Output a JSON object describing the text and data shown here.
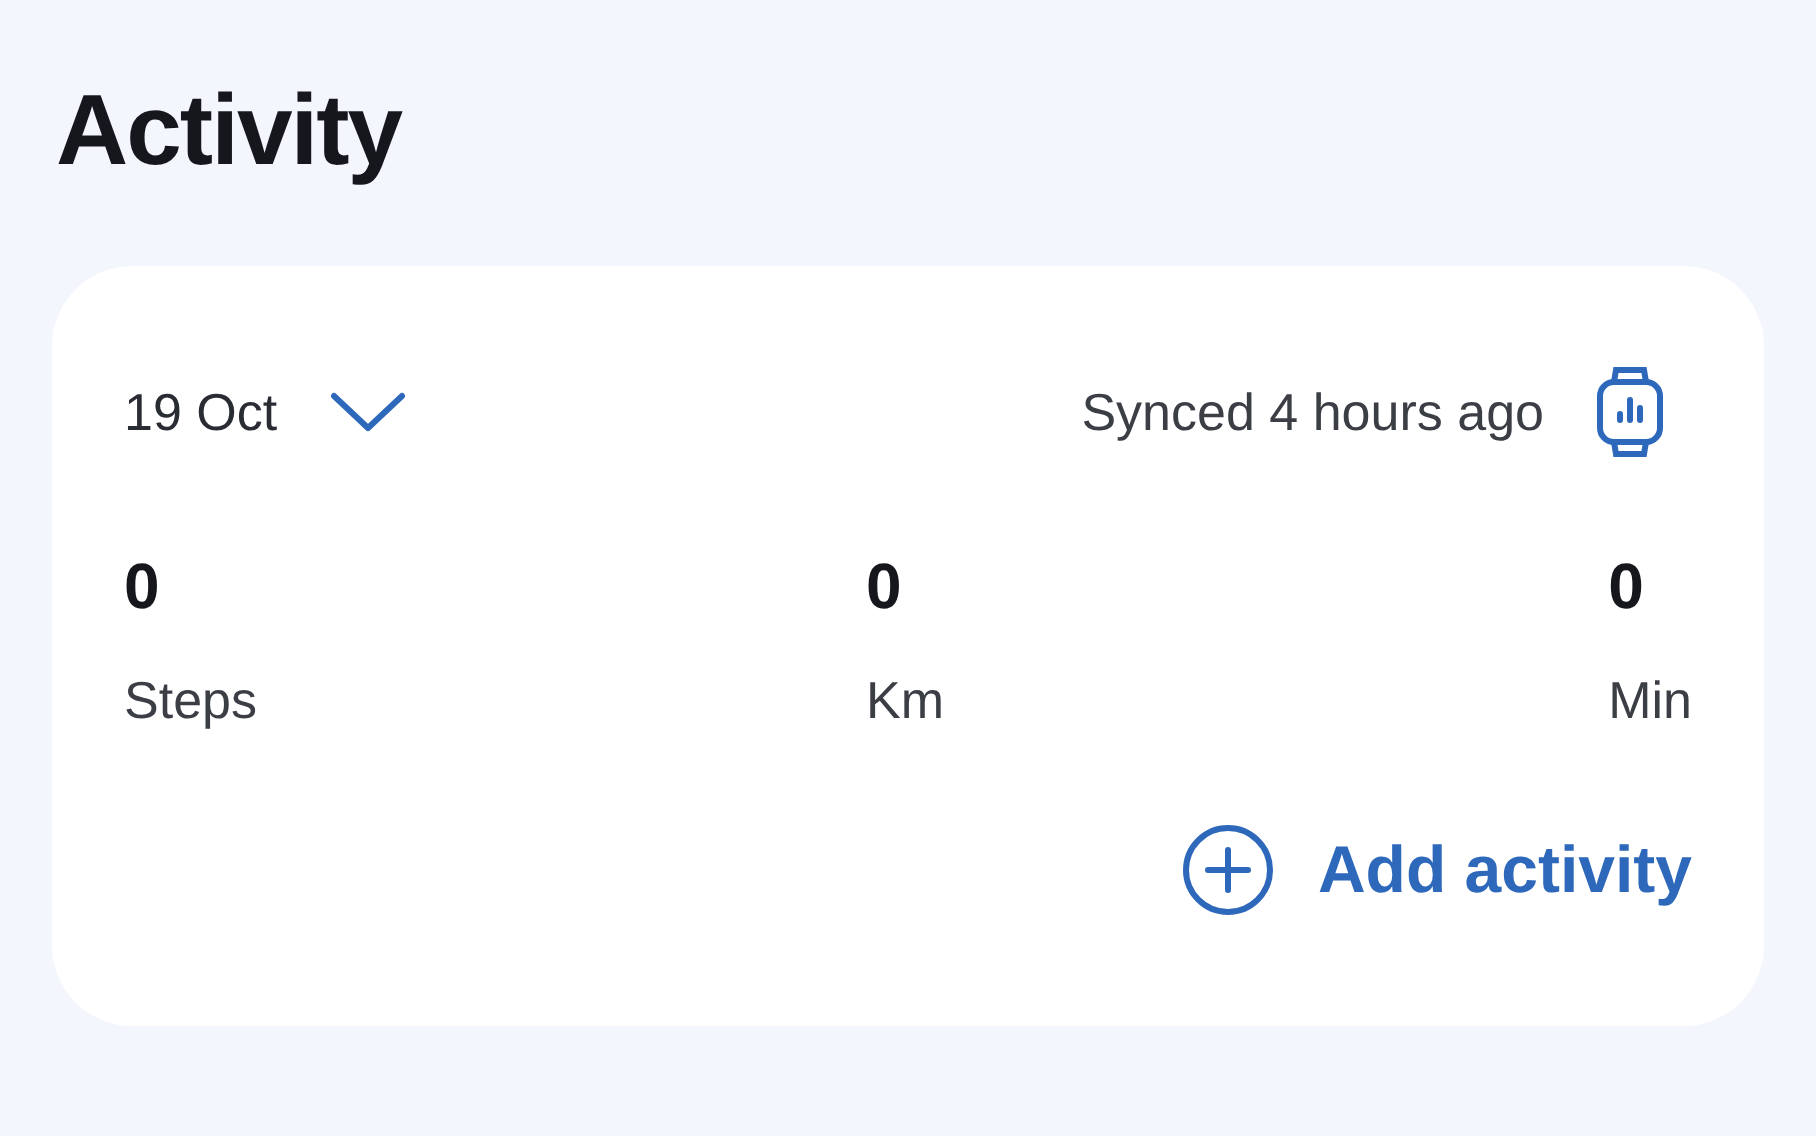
{
  "title": "Activity",
  "card": {
    "date": "19 Oct",
    "sync_status": "Synced 4 hours ago",
    "stats": [
      {
        "value": "0",
        "label": "Steps"
      },
      {
        "value": "0",
        "label": "Km"
      },
      {
        "value": "0",
        "label": "Min"
      }
    ],
    "add_button": "Add activity"
  }
}
